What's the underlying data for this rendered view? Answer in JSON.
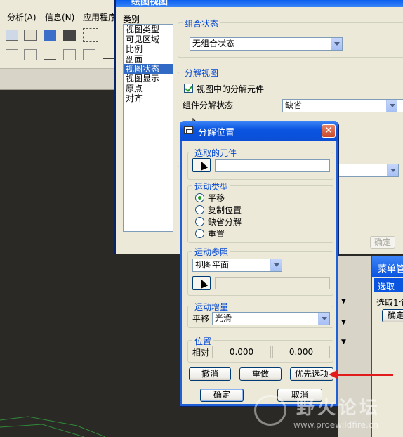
{
  "app": {
    "menu": {
      "analysis": "分析(A)",
      "info": "信息(N)",
      "apps": "应用程序"
    }
  },
  "main_dialog": {
    "title": "绘图视图",
    "category_label": "类别",
    "categories": [
      "视图类型",
      "可见区域",
      "比例",
      "剖面",
      "视图状态",
      "视图显示",
      "原点",
      "对齐"
    ],
    "selected_category": "视图状态",
    "combo_group": {
      "title": "组合状态",
      "value": "无组合状态"
    },
    "explode_group": {
      "title": "分解视图",
      "checkbox_label": "视图中的分解元件",
      "checked": true,
      "state_label": "组件分解状态",
      "state_value": "缺省"
    },
    "ok_label": "确定"
  },
  "explode_dialog": {
    "title": "分解位置",
    "close_label": "✕",
    "selected_parts": {
      "title": "选取的元件",
      "value": ""
    },
    "motion_type": {
      "title": "运动类型",
      "options": [
        "平移",
        "复制位置",
        "缺省分解",
        "重置"
      ],
      "selected": "平移"
    },
    "motion_ref": {
      "title": "运动参照",
      "value": "视图平面",
      "ref_value": ""
    },
    "motion_increment": {
      "title": "运动增量",
      "label": "平移",
      "value": "光滑"
    },
    "position": {
      "title": "位置",
      "label": "相对",
      "x": "0.000",
      "y": "0.000"
    },
    "buttons": {
      "undo": "撤消",
      "redo": "重做",
      "preferences": "优先选项"
    },
    "ok": "确定",
    "cancel": "取消"
  },
  "menu_manager": {
    "title": "菜单管",
    "select_title": "选取",
    "select_hint": "选取1个",
    "ok": "确定"
  },
  "watermark": {
    "title": "野火论坛",
    "url": "www.proewildfire.cn"
  },
  "colors": {
    "xp_blue": "#0a54e0",
    "dialog_bg": "#ece9d8",
    "arrow": "#e21c1c",
    "group_title": "#0046d5"
  }
}
